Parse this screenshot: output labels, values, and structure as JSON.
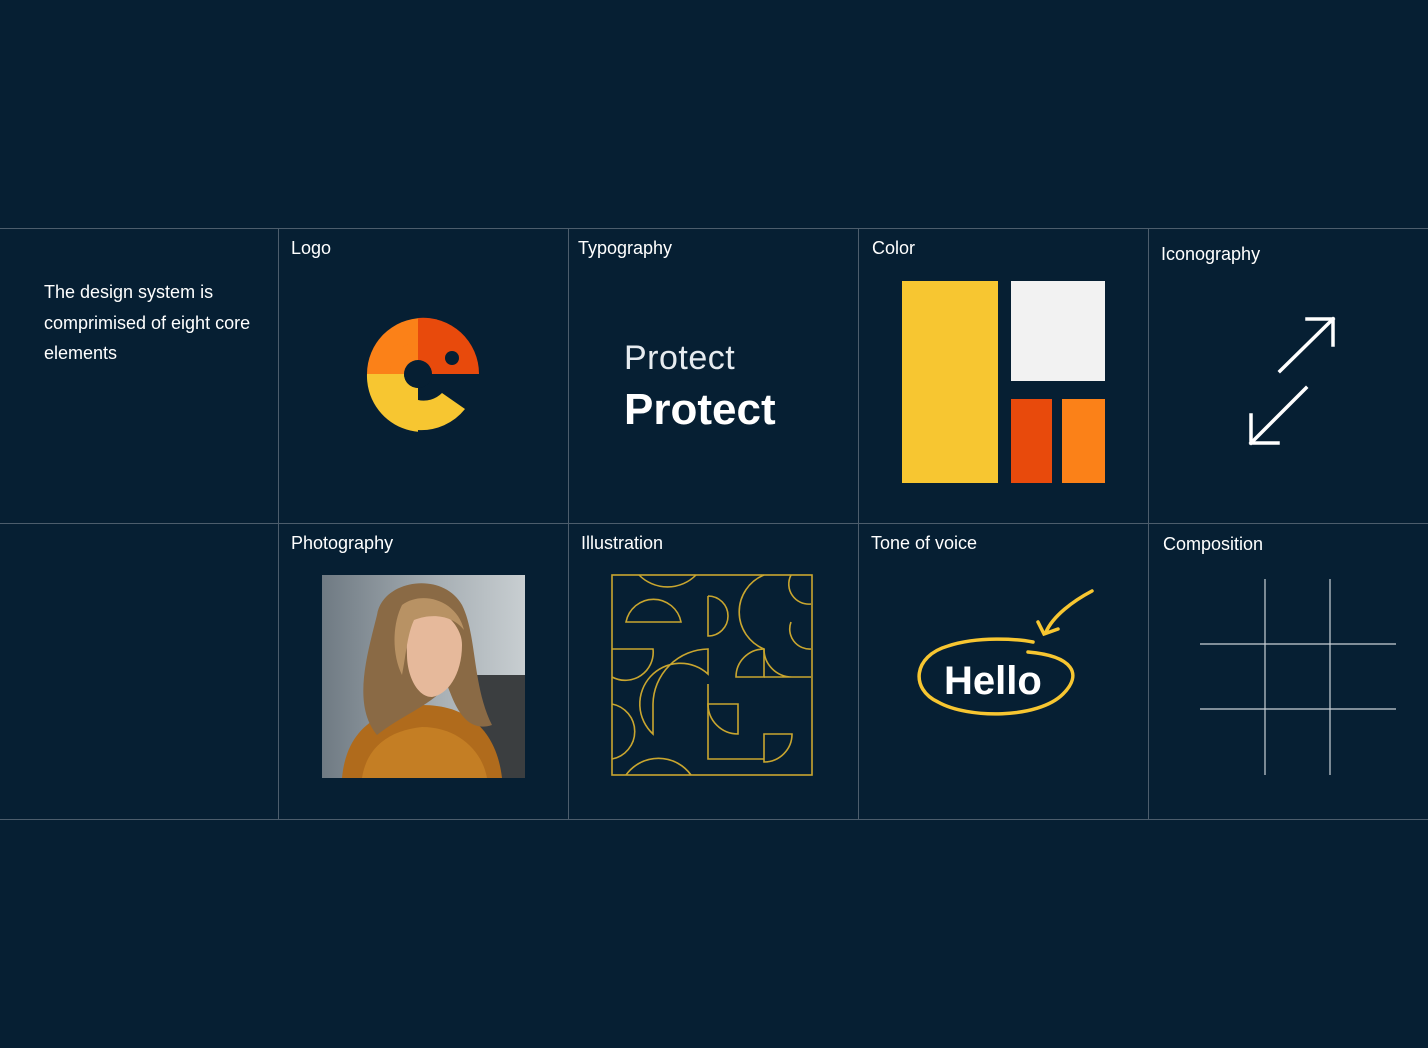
{
  "intro": "The design system is comprimised of eight core elements",
  "cells": {
    "logo": "Logo",
    "typography": "Typography",
    "color": "Color",
    "iconography": "Iconography",
    "photography": "Photography",
    "illustration": "Illustration",
    "tone_of_voice": "Tone of voice",
    "composition": "Composition"
  },
  "typography_sample": {
    "light": "Protect",
    "bold": "Protect"
  },
  "tone_sample": "Hello",
  "colors": {
    "background": "#061f33",
    "yellow": "#f7c631",
    "white": "#f2f2f2",
    "red": "#e84a0c",
    "orange": "#fb8118",
    "illustration_gold": "#c9a62f"
  },
  "icons": {
    "iconography": "expand-arrows-icon"
  }
}
